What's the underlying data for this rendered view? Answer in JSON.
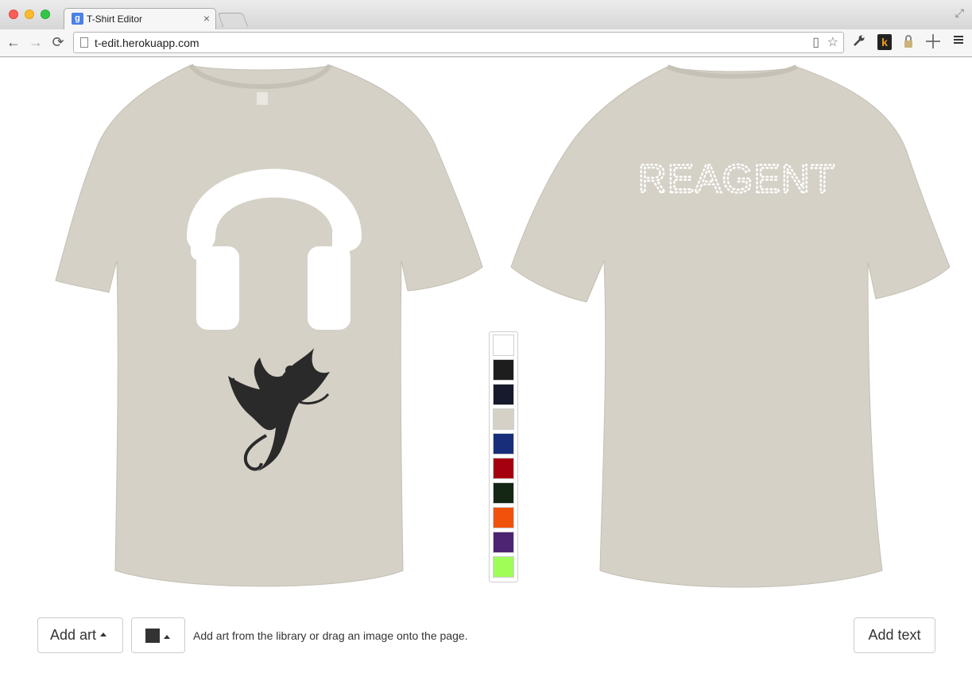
{
  "browser": {
    "tab_title": "T-Shirt Editor",
    "tab_favicon": "g",
    "tab_close": "×",
    "url": "t-edit.herokuapp.com",
    "nav": {
      "back": "←",
      "forward": "→",
      "reload": "⟳"
    },
    "icons": [
      "expand-icon",
      "page-icon",
      "reader-icon",
      "star-icon",
      "wrench-icon",
      "k-extension-icon",
      "lock-extension-icon",
      "crosshair-icon",
      "menu-icon"
    ],
    "ext_k": "k"
  },
  "editor": {
    "shirt_color": "#d5d1c7",
    "front": {
      "art": [
        "headphones-art",
        "phoenix-art"
      ]
    },
    "back": {
      "text": "REAGENT"
    },
    "swatches": [
      {
        "name": "white",
        "color": "#ffffff"
      },
      {
        "name": "black",
        "color": "#1d1d1d"
      },
      {
        "name": "navy-black",
        "color": "#161a2c"
      },
      {
        "name": "natural",
        "color": "#d5d1c7",
        "selected": true
      },
      {
        "name": "royal-blue",
        "color": "#182e7a"
      },
      {
        "name": "red",
        "color": "#a50010"
      },
      {
        "name": "forest",
        "color": "#142714"
      },
      {
        "name": "orange",
        "color": "#f0520c"
      },
      {
        "name": "purple",
        "color": "#4b2472"
      },
      {
        "name": "lime",
        "color": "#a0fc57"
      }
    ]
  },
  "controls": {
    "add_art_label": "Add art",
    "ink_color": "#333333",
    "help_text": "Add art from the library or drag an image onto the page.",
    "add_text_label": "Add text"
  }
}
